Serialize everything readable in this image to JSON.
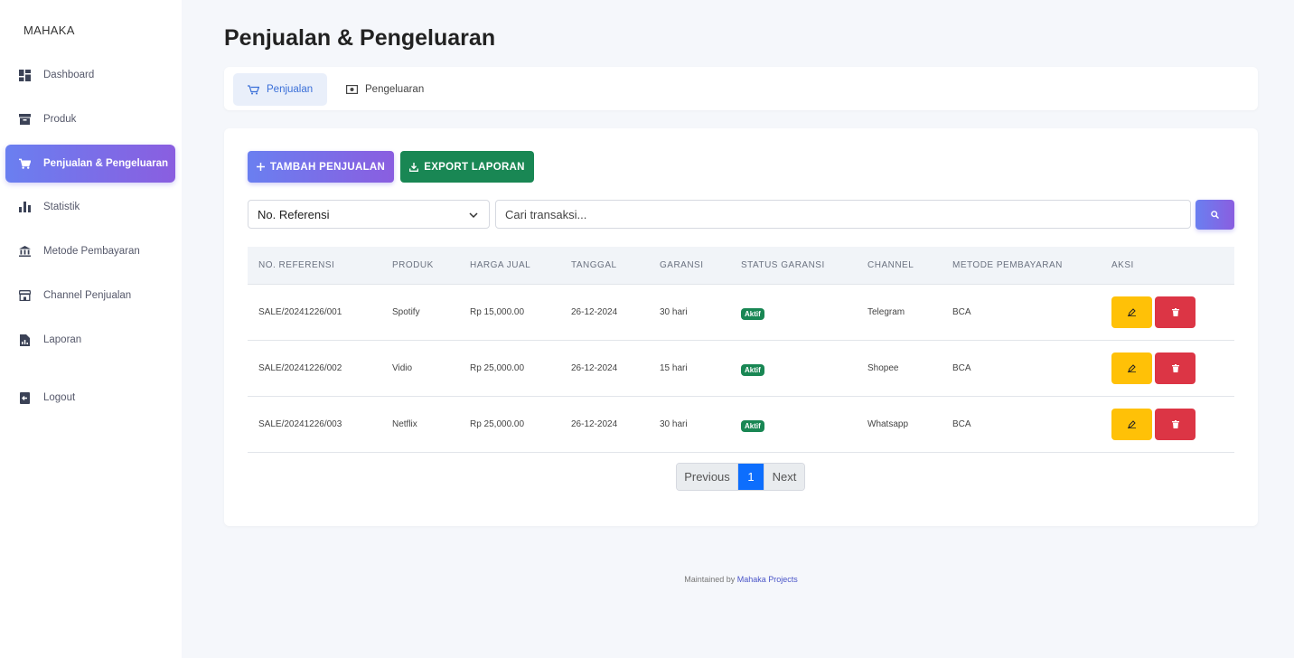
{
  "sidebar": {
    "brand": "MAHAKA",
    "items": [
      {
        "label": "Dashboard",
        "icon": "dashboard-icon"
      },
      {
        "label": "Produk",
        "icon": "archive-icon"
      },
      {
        "label": "Penjualan & Pengeluaran",
        "icon": "cart-icon",
        "active": true
      },
      {
        "label": "Statistik",
        "icon": "bar-chart-icon"
      },
      {
        "label": "Metode Pembayaran",
        "icon": "bank-icon"
      },
      {
        "label": "Channel Penjualan",
        "icon": "store-icon"
      },
      {
        "label": "Laporan",
        "icon": "report-icon"
      }
    ],
    "logout": {
      "label": "Logout",
      "icon": "logout-icon"
    }
  },
  "page": {
    "title": "Penjualan & Pengeluaran"
  },
  "tabs": [
    {
      "label": "Penjualan",
      "icon": "cart-icon",
      "active": true
    },
    {
      "label": "Pengeluaran",
      "icon": "money-icon",
      "active": false
    }
  ],
  "toolbar": {
    "add_label": "TAMBAH PENJUALAN",
    "export_label": "EXPORT LAPORAN"
  },
  "filter": {
    "select_value": "No. Referensi",
    "search_placeholder": "Cari transaksi..."
  },
  "table": {
    "headers": [
      "NO. REFERENSI",
      "PRODUK",
      "HARGA JUAL",
      "TANGGAL",
      "GARANSI",
      "STATUS GARANSI",
      "CHANNEL",
      "METODE PEMBAYARAN",
      "AKSI"
    ],
    "rows": [
      {
        "ref": "SALE/20241226/001",
        "produk": "Spotify",
        "harga": "Rp 15,000.00",
        "tanggal": "26-12-2024",
        "garansi": "30 hari",
        "status": "Aktif",
        "channel": "Telegram",
        "metode": "BCA"
      },
      {
        "ref": "SALE/20241226/002",
        "produk": "Vidio",
        "harga": "Rp 25,000.00",
        "tanggal": "26-12-2024",
        "garansi": "15 hari",
        "status": "Aktif",
        "channel": "Shopee",
        "metode": "BCA"
      },
      {
        "ref": "SALE/20241226/003",
        "produk": "Netflix",
        "harga": "Rp 25,000.00",
        "tanggal": "26-12-2024",
        "garansi": "30 hari",
        "status": "Aktif",
        "channel": "Whatsapp",
        "metode": "BCA"
      }
    ]
  },
  "pagination": {
    "prev": "Previous",
    "current": "1",
    "next": "Next"
  },
  "footer": {
    "text": "Maintained by",
    "link": "Mahaka Projects"
  },
  "colors": {
    "accent_gradient_start": "#6a7ff0",
    "accent_gradient_end": "#8a5ee0",
    "export_green": "#198754",
    "edit_yellow": "#ffc107",
    "delete_red": "#dc3545",
    "page_active": "#0d6efd"
  }
}
